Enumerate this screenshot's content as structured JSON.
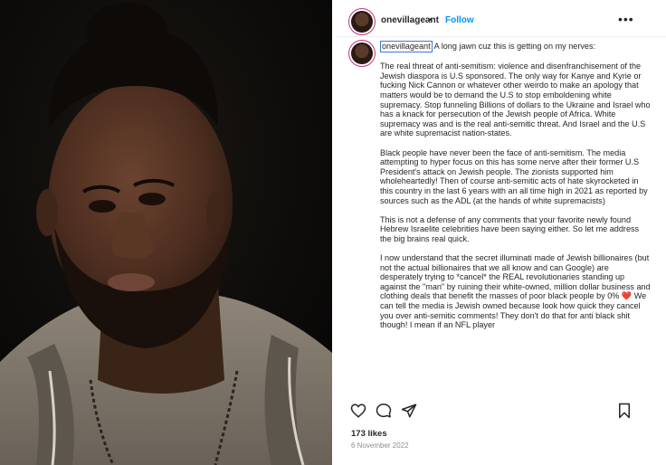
{
  "post": {
    "username": "onevillageant",
    "separator": "•",
    "follow_label": "Follow",
    "more_label": "•••",
    "caption": {
      "username": "onevillageant",
      "first_line": "A long jawn cuz this is getting on my nerves:",
      "paragraphs": [
        "The real threat of anti-semitism: violence and disenfranchisement of the Jewish diaspora is U.S sponsored. The only way for Kanye and Kyrie or fucking Nick Cannon or whatever other weirdo to make an apology that matters would be to demand the U.S to stop emboldening white supremacy. Stop funneling Billions of dollars to the Ukraine and Israel who has a knack for persecution of the Jewish people of Africa. White supremacy was and is the real anti-semitic threat. And Israel and the U.S are white supremacist nation-states.",
        "Black people have never been the face of anti-semitism. The media attempting to hyper focus on this has some nerve after their former U.S President's attack on Jewish people. The zionists supported him wholeheartedly! Then of course anti-semitic acts of hate skyrocketed in this country in the last 6 years with an all time high in 2021 as reported by sources such as the ADL (at the hands of white supremacists)",
        "This is not a defense of any comments that your favorite newly found Hebrew Israelite celebrities have been saying either. So let me address the big brains real quick.",
        "I now understand that the secret illuminati made of Jewish billionaires (but not the actual billionaires that we all know and can Google) are desperately trying to *cancel* the REAL revolutionaries standing up against the \"man\" by ruining their white-owned, million dollar business and clothing deals that benefit the masses of poor black people by 0% ❤️ We can tell the media is Jewish owned because look how quick they cancel you over anti-semitic comments! They don't do that for anti black shit though! I mean if an NFL player"
      ]
    },
    "actions": {
      "like_icon": "heart-icon",
      "comment_icon": "comment-icon",
      "share_icon": "send-icon",
      "save_icon": "bookmark-icon"
    },
    "likes": "173 likes",
    "date": "6 November 2022",
    "colors": {
      "follow": "#0095f6",
      "text": "#262626",
      "muted": "#8e8e8e",
      "ring": "#c13584"
    }
  },
  "photo": {
    "subject": "portrait-photo"
  }
}
